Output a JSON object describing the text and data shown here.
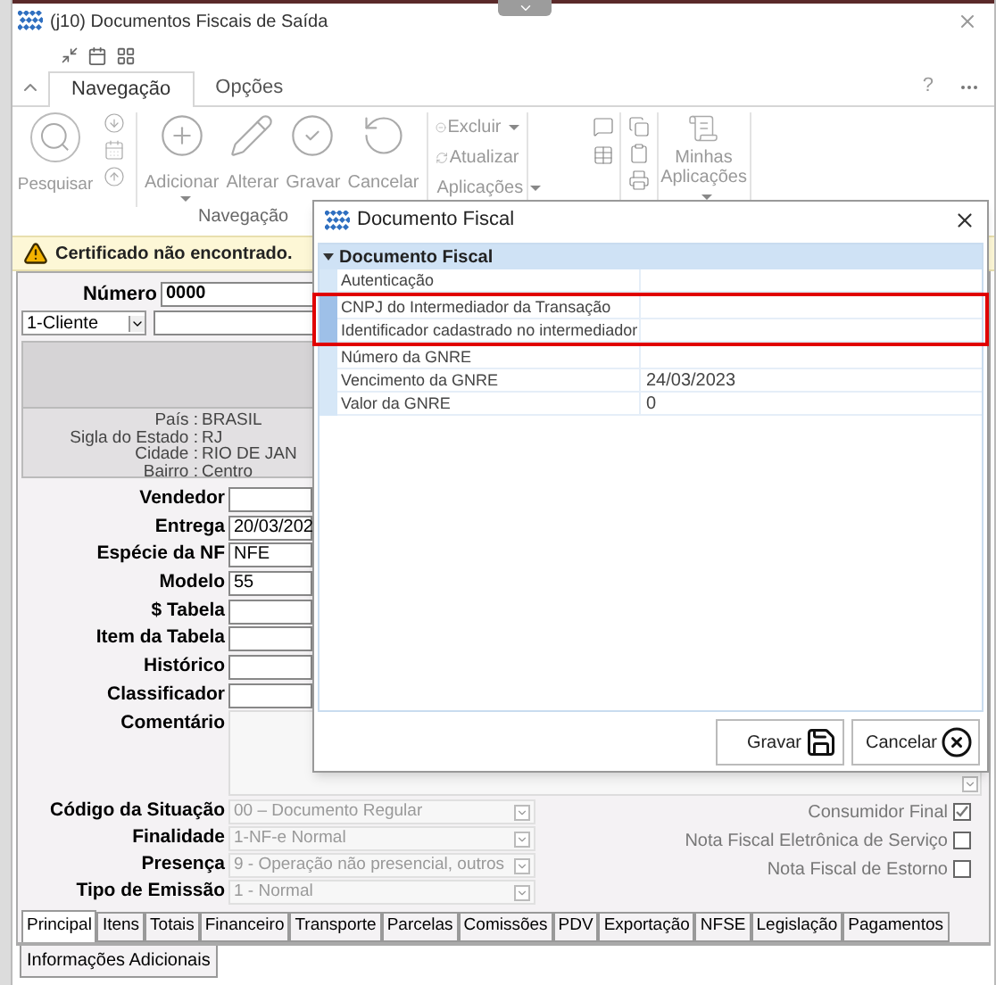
{
  "window": {
    "title": "(j10) Documentos Fiscais de Saída"
  },
  "ribbon": {
    "tabs": [
      {
        "label": "Navegação",
        "selected": true
      },
      {
        "label": "Opções",
        "selected": false
      }
    ],
    "help": "?",
    "search_button": {
      "label": "Pesquisar"
    },
    "action_buttons": [
      {
        "label": "Adicionar",
        "dropdown": true
      },
      {
        "label": "Alterar",
        "dropdown": false
      },
      {
        "label": "Gravar",
        "dropdown": false
      },
      {
        "label": "Cancelar",
        "dropdown": false
      }
    ],
    "menu_items": [
      {
        "label": "Excluir",
        "dropdown": true
      },
      {
        "label": "Atualizar",
        "dropdown": false
      },
      {
        "label": "Aplicações",
        "dropdown": true
      }
    ],
    "apps_button": {
      "label": "Minhas Aplicações",
      "dropdown": true
    },
    "group_label": "Navegação"
  },
  "warning": "Certificado não encontrado.",
  "numero": {
    "label": "Número",
    "value": "0000"
  },
  "party": {
    "value": "1-Cliente"
  },
  "address": [
    {
      "label": "País :",
      "value": "BRASIL"
    },
    {
      "label": "Sigla do Estado :",
      "value": "RJ"
    },
    {
      "label": "Cidade :",
      "value": "RIO DE JAN"
    },
    {
      "label": "Bairro :",
      "value": "Centro"
    }
  ],
  "fields": [
    {
      "label": "Vendedor"
    },
    {
      "label": "Entrega",
      "value": "20/03/202"
    },
    {
      "label": "Espécie da NF",
      "value": "NFE"
    },
    {
      "label": "Modelo",
      "value": "55"
    },
    {
      "label": "$ Tabela"
    },
    {
      "label": "Item da Tabela"
    },
    {
      "label": "Histórico"
    },
    {
      "label": "Classificador"
    }
  ],
  "comment": {
    "label": "Comentário"
  },
  "selects": [
    {
      "label": "Código da Situação",
      "value": "00 – Documento Regular",
      "disabled": true
    },
    {
      "label": "Finalidade",
      "value": "1-NF-e Normal",
      "disabled": true
    },
    {
      "label": "Presença",
      "value": "9 - Operação não presencial, outros",
      "disabled": true
    },
    {
      "label": "Tipo de Emissão",
      "value": "1 - Normal",
      "disabled": true
    }
  ],
  "flags": [
    {
      "label": "Consumidor Final",
      "checked": true
    },
    {
      "label": "Nota Fiscal Eletrônica de Serviço",
      "checked": false
    },
    {
      "label": "Nota Fiscal de Estorno",
      "checked": false
    }
  ],
  "tabs": [
    {
      "label": "Principal",
      "selected": true
    },
    {
      "label": "Itens",
      "selected": false
    },
    {
      "label": "Totais",
      "selected": false
    },
    {
      "label": "Financeiro",
      "selected": false
    },
    {
      "label": "Transporte",
      "selected": false
    },
    {
      "label": "Parcelas",
      "selected": false
    },
    {
      "label": "Comissões",
      "selected": false
    },
    {
      "label": "PDV",
      "selected": false
    },
    {
      "label": "Exportação",
      "selected": false
    },
    {
      "label": "NFSE",
      "selected": false
    },
    {
      "label": "Legislação",
      "selected": false
    },
    {
      "label": "Pagamentos",
      "selected": false
    }
  ],
  "tabs_second_row": [
    {
      "label": "Informações Adicionais",
      "selected": false
    }
  ],
  "dialog": {
    "title": "Documento Fiscal",
    "section": "Documento Fiscal",
    "expanded": true,
    "properties": [
      {
        "name": "Autenticação",
        "highlighted": false
      },
      {
        "name": "CNPJ do Intermediador da Transação",
        "highlighted": true
      },
      {
        "name": "Identificador cadastrado no intermediador",
        "highlighted": true
      },
      {
        "name": "Número da GNRE",
        "highlighted": false
      },
      {
        "name": "Vencimento da GNRE",
        "value": "24/03/2023",
        "highlighted": false
      },
      {
        "name": "Valor da GNRE",
        "value": "0",
        "highlighted": false
      }
    ],
    "buttons": [
      {
        "kind": "save",
        "label": "Gravar"
      },
      {
        "kind": "cancel",
        "label": "Cancelar"
      }
    ]
  }
}
